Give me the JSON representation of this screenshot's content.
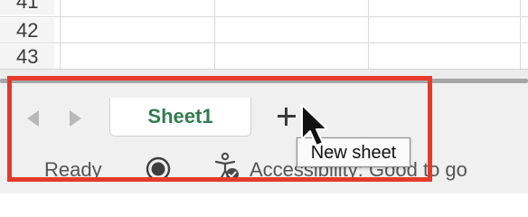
{
  "grid": {
    "rows": [
      {
        "number": "41"
      },
      {
        "number": "42"
      },
      {
        "number": "43"
      }
    ]
  },
  "sheet_tabs": [
    {
      "label": "Sheet1",
      "active": true
    }
  ],
  "add_sheet": {
    "label": "+",
    "tooltip": "New sheet"
  },
  "nav": {
    "prev_icon": "chevron-left-icon",
    "next_icon": "chevron-right-icon"
  },
  "status_bar": {
    "ready": "Ready",
    "macro_icon": "record-macro-icon",
    "accessibility_icon": "accessibility-check-icon",
    "accessibility": "Accessibility: Good to go"
  },
  "colors": {
    "active_tab_text": "#2f7d4d",
    "highlight": "#e53a2b"
  }
}
